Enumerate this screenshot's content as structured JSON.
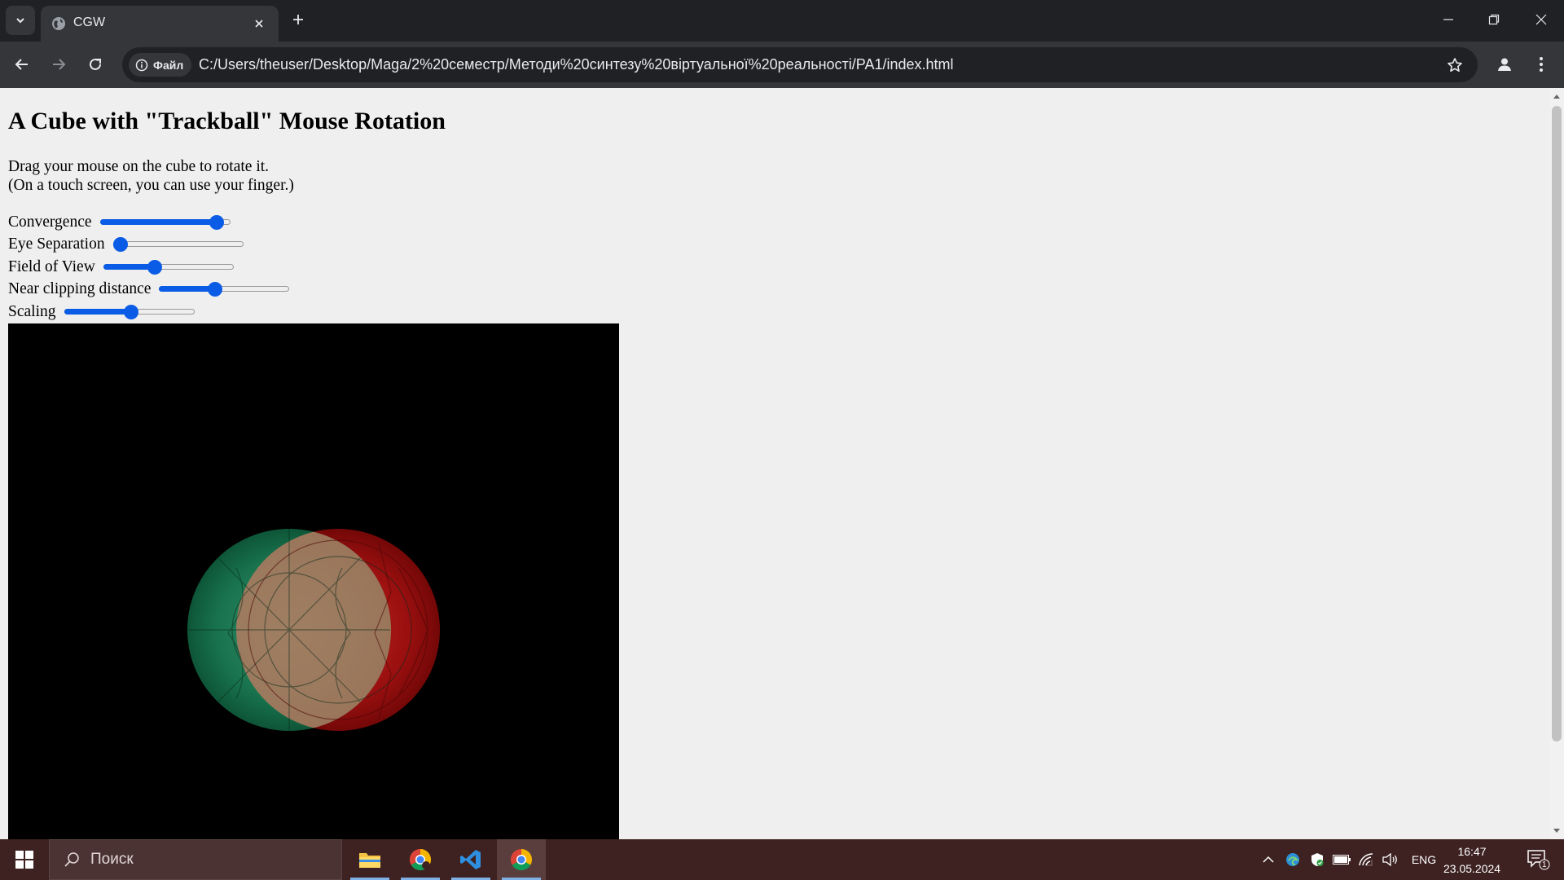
{
  "browser": {
    "tab_title": "CGW",
    "site_info_label": "Файл",
    "url": "C:/Users/theuser/Desktop/Maga/2%20семестр/Методи%20синтезу%20віртуальної%20реальності/PA1/index.html"
  },
  "page": {
    "heading": "A Cube with \"Trackball\" Mouse Rotation",
    "desc_line1": "Drag your mouse on the cube to rotate it.",
    "desc_line2": "(On a touch screen, you can use your finger.)",
    "controls": [
      {
        "label": "Convergence",
        "value": 0.95
      },
      {
        "label": "Eye Separation",
        "value": 0.0
      },
      {
        "label": "Field of View",
        "value": 0.38
      },
      {
        "label": "Near clipping distance",
        "value": 0.42
      },
      {
        "label": "Scaling",
        "value": 0.52
      }
    ]
  },
  "taskbar": {
    "search_placeholder": "Поиск",
    "language": "ENG",
    "time": "16:47",
    "date": "23.05.2024",
    "notification_count": "1"
  },
  "colors": {
    "accent": "#0a5ce6",
    "anaglyph_left": "#1f8a5a",
    "anaglyph_right": "#b01010"
  }
}
